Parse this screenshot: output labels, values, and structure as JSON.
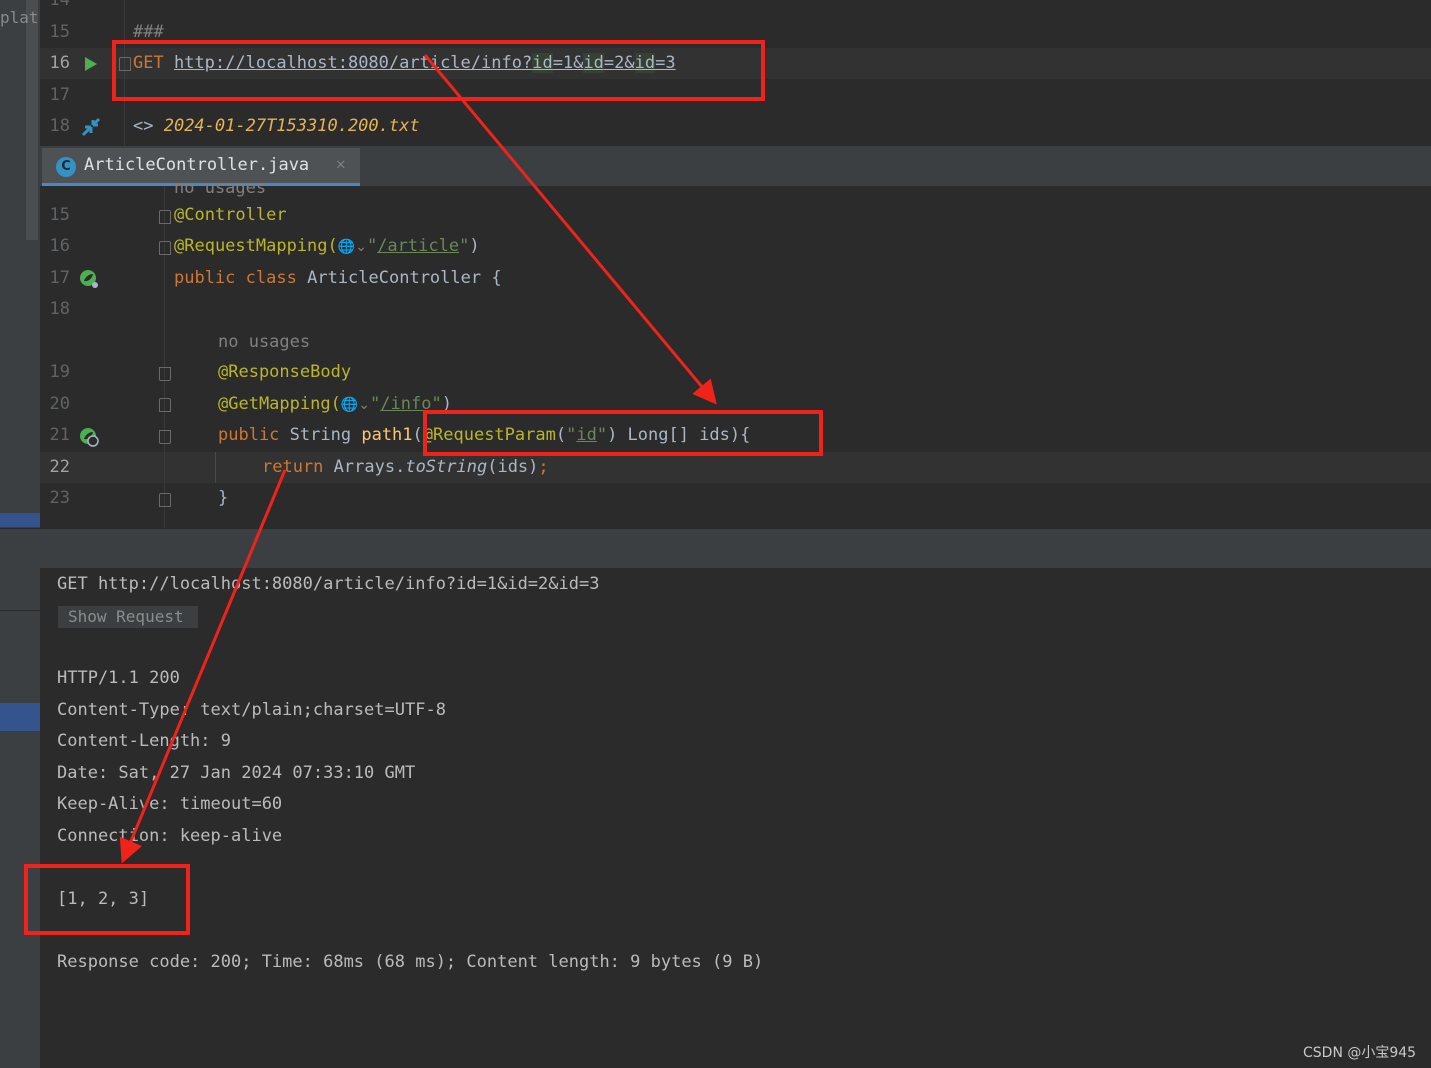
{
  "left_strip": {
    "text": "plat"
  },
  "http_editor": {
    "lines": [
      {
        "num": "14",
        "text": ""
      },
      {
        "num": "15",
        "text": "###"
      },
      {
        "num": "16",
        "method": "GET",
        "url": "http://localhost:8080/article/info?",
        "p1": "id",
        "v1": "=1&",
        "p2": "id",
        "v2": "=2&",
        "p3": "id",
        "v3": "=3"
      },
      {
        "num": "17",
        "text": ""
      },
      {
        "num": "18",
        "prefix": "<> ",
        "file": "2024-01-27T153310.200.txt"
      }
    ]
  },
  "tab": {
    "label": "ArticleController.java",
    "icon": "C",
    "close": "✕"
  },
  "java_editor": {
    "partial_top": "no usages",
    "lines": [
      {
        "num": "15"
      },
      {
        "num": "16"
      },
      {
        "num": "17"
      },
      {
        "num": "18"
      },
      {
        "num": "19"
      },
      {
        "num": "20"
      },
      {
        "num": "21"
      },
      {
        "num": "22"
      },
      {
        "num": "23"
      }
    ],
    "l15": "@Controller",
    "l16_ann": "@RequestMapping(",
    "l16_glyph": "🌐⌄",
    "l16_q1": "\"",
    "l16_path": "/article",
    "l16_q2": "\"",
    "l16_end": ")",
    "l17_kw1": "public",
    "l17_kw2": "class",
    "l17_rest": "ArticleController {",
    "hint": "no usages",
    "l19": "@ResponseBody",
    "l20_ann": "@GetMapping(",
    "l20_glyph": "🌐⌄",
    "l20_q1": "\"",
    "l20_path": "/info",
    "l20_q2": "\"",
    "l20_end": ")",
    "l21_kw": "public",
    "l21_type": "String",
    "l21_name": "path1",
    "l21_paren": "(",
    "l21_ann": "@RequestParam",
    "l21_p1": "(",
    "l21_str_q1": "\"",
    "l21_str": "id",
    "l21_str_q2": "\"",
    "l21_rest": ") Long[] ids){",
    "l22_kw": "return",
    "l22_cls": "Arrays.",
    "l22_method": "toString",
    "l22_rest": "(ids)",
    "l22_semi": ";",
    "l23": "}"
  },
  "output": {
    "request_line": "GET http://localhost:8080/article/info?id=1&id=2&id=3",
    "show_request": "Show Request",
    "status": "HTTP/1.1 200",
    "headers": [
      "Content-Type: text/plain;charset=UTF-8",
      "Content-Length: 9",
      "Date: Sat, 27 Jan 2024 07:33:10 GMT",
      "Keep-Alive: timeout=60",
      "Connection: keep-alive"
    ],
    "body": "[1, 2, 3]",
    "summary": "Response code: 200; Time: 68ms (68 ms); Content length: 9 bytes (9 B)"
  },
  "watermark": "CSDN @小宝945",
  "colors": {
    "annotation_red": "#f0231a",
    "keyword": "#cc7832",
    "annotation": "#bbb529",
    "string": "#6a8759"
  }
}
